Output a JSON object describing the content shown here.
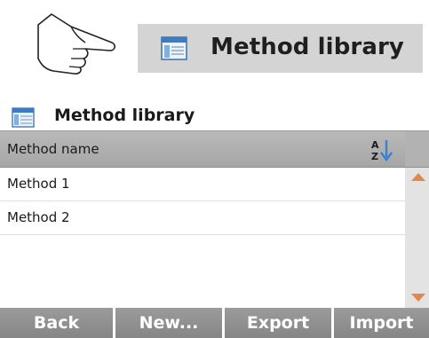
{
  "hero": {
    "hand_icon": "pointing-hand-icon",
    "button_label": "Method library",
    "button_icon": "window-list-icon"
  },
  "panel": {
    "title": "Method library",
    "title_icon": "window-list-icon",
    "column_header": "Method name",
    "sort_icon": "sort-az-icon",
    "rows": [
      {
        "name": "Method 1"
      },
      {
        "name": "Method 2"
      }
    ],
    "scroll_icons": {
      "up": "scroll-up-icon",
      "down": "scroll-down-icon"
    }
  },
  "toolbar": {
    "back_label": "Back",
    "new_label": "New...",
    "export_label": "Export",
    "import_label": "Import"
  },
  "colors": {
    "accent": "#e0874a",
    "sort_arrow": "#3b7fd1",
    "header_gray": "#a6a6a6",
    "button_gray": "#868686"
  }
}
